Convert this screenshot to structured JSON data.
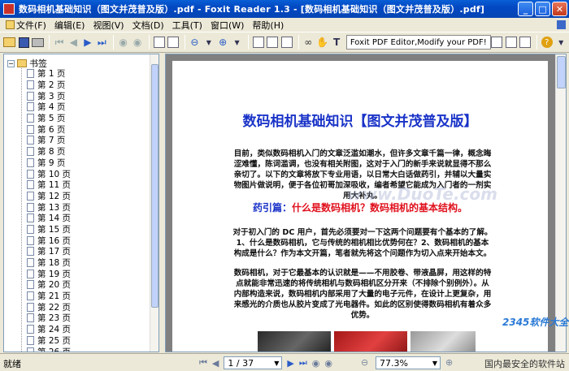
{
  "window": {
    "title": "数码相机基础知识（图文并茂普及版）.pdf - Foxit Reader 1.3 - [数码相机基础知识（图文并茂普及版）.pdf]",
    "min": "_",
    "max": "□",
    "close": "✕"
  },
  "menu": [
    {
      "label": "文件(F)"
    },
    {
      "label": "编辑(E)"
    },
    {
      "label": "视图(V)"
    },
    {
      "label": "文档(D)"
    },
    {
      "label": "工具(T)"
    },
    {
      "label": "窗口(W)"
    },
    {
      "label": "帮助(H)"
    }
  ],
  "toolbar": {
    "promo": "Foxit PDF Editor,Modify your PDF!"
  },
  "bookmarks": {
    "root": "书签",
    "items": [
      "第 1 页",
      "第 2 页",
      "第 3 页",
      "第 4 页",
      "第 5 页",
      "第 6 页",
      "第 7 页",
      "第 8 页",
      "第 9 页",
      "第 10 页",
      "第 11 页",
      "第 12 页",
      "第 13 页",
      "第 14 页",
      "第 15 页",
      "第 16 页",
      "第 17 页",
      "第 18 页",
      "第 19 页",
      "第 20 页",
      "第 21 页",
      "第 22 页",
      "第 23 页",
      "第 24 页",
      "第 25 页",
      "第 26 页"
    ]
  },
  "document": {
    "title": "数码相机基础知识【图文并茂普及版】",
    "para1": "目前，类似数码相机入门的文章泛滥如潮水，但许多文章千篇一律，概念晦涩难懂，陈词滥调，也没有相关附图，这对于入门的新手来说就显得不那么亲切了。以下的文章将放下专业用语，以日常大白话做药引，并辅以大量实物图片做说明，便于各位初哥加深吸收，编者希望它能成为入门者的一剂实用大补丸。",
    "subhead_lead": "药引篇：",
    "subhead_rest": "什么是数码相机？数码相机的基本结构。",
    "para2": "对于初入门的 DC 用户，首先必须要对一下这两个问题要有个基本的了解。1、什么是数码相机，它与传统的相机相比优势何在？2、数码相机的基本构成是什么？作为本文开篇，笔者就先将这个问题作为切入点来开始本文。",
    "para3": "数码相机，对于它最基本的认识就是——不用胶卷、带液晶屏，用这样的特点就能非常迅速的将传统相机与数码相机区分开来（不排除个别例外）。从内部构造来说，数码相机内部采用了大量的电子元件，在设计上更复杂，用来感光的介质也从胶片变成了光电器件。如此的区别使得数码相机有着众多优势。",
    "watermark": "www.DuoTe.com"
  },
  "status": {
    "text": "就绪",
    "page": "1 / 37",
    "zoom": "77.3%",
    "ad": "国内最安全的软件站",
    "logo": "2345软件大全"
  }
}
